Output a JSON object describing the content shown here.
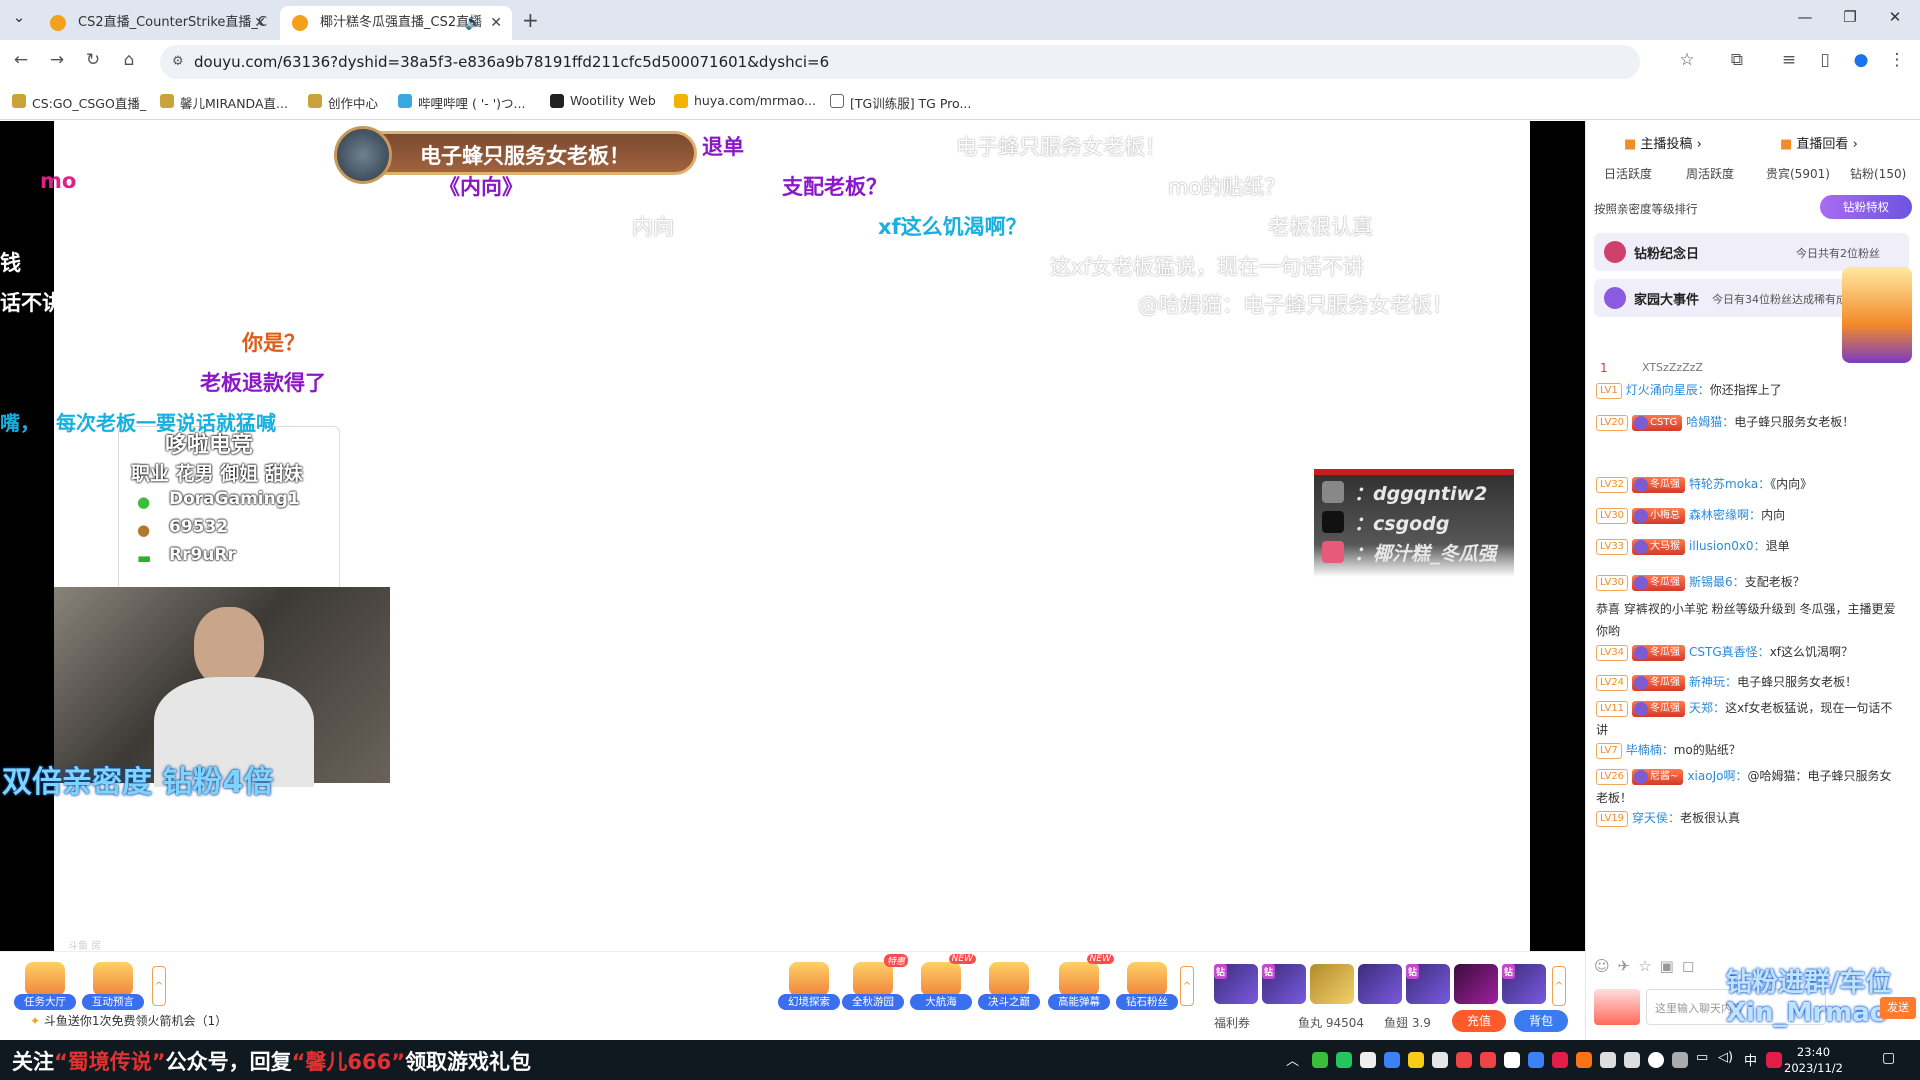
{
  "browser": {
    "tabs": [
      {
        "label": "CS2直播_CounterStrike直播_C"
      },
      {
        "label": "椰汁糕冬瓜强直播_CS2直播"
      }
    ],
    "url": "douyu.com/63136?dyshid=38a5f3-e836a9b78191ffd211cfc5d500071601&dyshci=6",
    "bookmarks": [
      "CS:GO_CSGO直播_",
      "馨儿MIRANDA直...",
      "创作中心",
      "哔哩哔哩 ( '- ')つ...",
      "Wootility Web",
      "huya.com/mrmao...",
      "[TG训练服] TG Pro..."
    ]
  },
  "stream": {
    "banner_text": "电子蜂只服务女老板！",
    "danmaku": [
      {
        "text": "mo",
        "color": "#e0208a"
      },
      {
        "text": "退单",
        "color": "#8a18c8"
      },
      {
        "text": "《内向》",
        "color": "#8a18c8"
      },
      {
        "text": "支配老板？",
        "color": "#8a18c8"
      },
      {
        "text": "xf这么饥渴啊？",
        "color": "#18b0e0"
      },
      {
        "text": "你是？",
        "color": "#e05a18"
      },
      {
        "text": "老板退款得了",
        "color": "#8a18c8"
      },
      {
        "text": "每次老板一要说话就猛喊",
        "color": "#18b0e0"
      },
      {
        "text": "电子蜂只服务女老板！",
        "color": "ghost"
      },
      {
        "text": "mo的贴纸？",
        "color": "ghost"
      },
      {
        "text": "内向",
        "color": "ghost"
      },
      {
        "text": "老板很认真",
        "color": "ghost"
      },
      {
        "text": "这xf女老板猛说，现在一句话不讲",
        "color": "ghost"
      },
      {
        "text": "@哈姆猫：电子蜂只服务女老板！",
        "color": "ghost"
      }
    ],
    "left_partial": [
      "钱",
      "话不讲",
      "嘴，"
    ],
    "info_card": {
      "title": "哆啦电竞",
      "tags": "职业 花男 御姐 甜妹",
      "lines": [
        "DoraGaming1",
        "69532",
        "Rr9uRr"
      ]
    },
    "promo_text": "双倍亲密度 钻粉4倍",
    "social": [
      "：dggqntiw2",
      "：csgodg",
      "：椰汁糕_冬瓜强"
    ],
    "footer_tiny": "斗鱼 房"
  },
  "controls": {
    "gifts": [
      {
        "label": "任务大厅",
        "new": ""
      },
      {
        "label": "互动预言",
        "new": ""
      },
      {
        "label": "幻境探索",
        "new": ""
      },
      {
        "label": "全秋游园",
        "new": "特惠"
      },
      {
        "label": "大航海",
        "new": "NEW"
      },
      {
        "label": "决斗之巅",
        "new": ""
      },
      {
        "label": "高能弹幕",
        "new": "NEW"
      },
      {
        "label": "钻石粉丝",
        "new": ""
      }
    ],
    "fans_tag": "钻",
    "note": "斗鱼送你1次免费领火箭机会（1）",
    "stats": [
      "福利券",
      "鱼丸 94504",
      "鱼翅 3.9"
    ],
    "recharge": "充值",
    "backpack": "背包"
  },
  "sidebar": {
    "top_links": [
      "主播投稿",
      "直播回看"
    ],
    "tabs": [
      "日活跃度",
      "周活跃度",
      "贵宾(5901)",
      "钻粉(150)"
    ],
    "sort_label": "按照亲密度等级排行",
    "privilege": "钻粉特权",
    "panel1": {
      "title": "钻粉纪念日",
      "note": "今日共有2位粉丝"
    },
    "panel2": {
      "title": "家园大事件",
      "note": "今日有34位粉丝达成稀有成就"
    },
    "top_user": {
      "rank": "1",
      "name": "XTSzZzZzZ"
    },
    "chat": [
      {
        "lv": "LV1",
        "badge": "",
        "name": "灯火涌向星辰：",
        "msg": "你还指挥上了"
      },
      {
        "lv": "LV20",
        "badge": "CSTG",
        "name": "哈姆猫：",
        "msg": "电子蜂只服务女老板！"
      },
      {
        "lv": "LV32",
        "badge": "冬瓜强",
        "name": "特轮苏moka：",
        "msg": "《内向》"
      },
      {
        "lv": "LV30",
        "badge": "小梅总",
        "name": "森林密缘啊：",
        "msg": "内向"
      },
      {
        "lv": "LV33",
        "badge": "大马猴",
        "name": "illusion0x0：",
        "msg": "退单"
      },
      {
        "lv": "LV30",
        "badge": "冬瓜强",
        "name": "斯锡最6：",
        "msg": "支配老板？"
      },
      {
        "lv": "",
        "badge": "",
        "name": "",
        "msg": "恭喜 穿裤衩的小羊驼 粉丝等级升级到 冬瓜强，主播更爱你哟"
      },
      {
        "lv": "LV34",
        "badge": "冬瓜强",
        "name": "CSTG真香怪：",
        "msg": "xf这么饥渴啊？"
      },
      {
        "lv": "LV24",
        "badge": "冬瓜强",
        "name": "新神玩：",
        "msg": "电子蜂只服务女老板！"
      },
      {
        "lv": "LV11",
        "badge": "冬瓜强",
        "name": "天郑：",
        "msg": "这xf女老板猛说，现在一句话不讲"
      },
      {
        "lv": "LV7",
        "badge": "",
        "name": "毕楠楠：",
        "msg": "mo的贴纸？"
      },
      {
        "lv": "LV26",
        "badge": "尼酱~",
        "name": "xiaoJo啊：",
        "msg": "@哈姆猫：电子蜂只服务女老板！"
      },
      {
        "lv": "LV19",
        "badge": "",
        "name": "穿天侯：",
        "msg": "老板很认真"
      }
    ],
    "input_placeholder": "这里输入聊天内容",
    "overlay": [
      "钻粉进群/车位",
      "Xin_Mrmao"
    ],
    "send": "发送"
  },
  "taskbar": {
    "ticker": [
      "关注",
      "“蜀境传说”",
      "公众号，回复",
      "“馨儿666”",
      "领取游戏礼包"
    ],
    "time": "23:40",
    "date": "2023/11/2",
    "ime": "中"
  }
}
